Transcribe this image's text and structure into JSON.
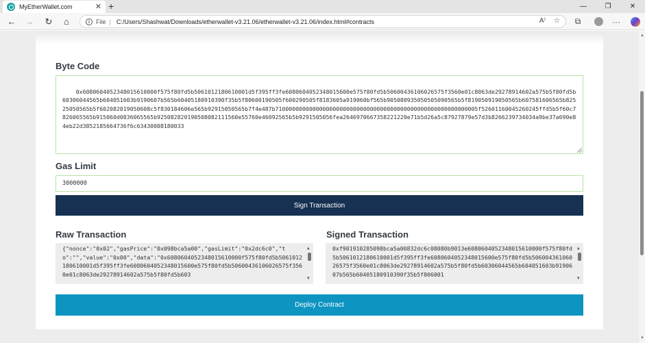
{
  "browser": {
    "tab_title": "MyEtherWallet.com",
    "tab_close": "✕",
    "new_tab": "+",
    "window_controls": {
      "minimize": "—",
      "maximize": "❐",
      "close": "✕"
    },
    "nav": {
      "back": "←",
      "forward": "→",
      "reload": "↻",
      "home": "⌂"
    },
    "address": {
      "scheme_label": "File",
      "separator": "|",
      "url": "C:/Users/Shashwat/Downloads/etherwallet-v3.21.06/etherwallet-v3.21.06/index.html#contracts"
    },
    "icons": {
      "read_aloud": "A⁾",
      "favorite": "☆",
      "extensions": "⧉",
      "more": "···"
    }
  },
  "contract": {
    "bytecode_label": "Byte Code",
    "bytecode_value": "0x6080604052348015610000f575f80fd5b5061012180610001d5f395ff3fe6080604052348015600e575f80fd5b50600436106026575f3560e01c8063de29278914602a575b5f80fd5b60306044565b604051603b9190607b565b60405180910390f35b5f80600190505f600290505f8183605a919060bf565b905080935050505090565b5f819050919050565b607581606565b82525050565b5f602082019050608c5f830184606e565b92915050565b7f4e487b710000000000000000000000000000000000000000000000000000000005f52601160045260245ffd5b5f60c7826065565b915060d0836065565b925082820190508082111560e55760e46092565b5b9291505056fea2646970667358221220e71b5d26a5c87927879e57d3b8266239734034a9be37a690e84eb22d3852185664736f6c63430008180033",
    "gas_limit_label": "Gas Limit",
    "gas_limit_value": "3000000",
    "sign_button": "Sign Transaction",
    "raw_tx_label": "Raw Transaction",
    "raw_tx_value": "{\"nonce\":\"0x02\",\"gasPrice\":\"0x098bca5a00\",\"gasLimit\":\"0x2dc6c0\",\"to\":\"\",\"value\":\"0x00\",\"data\":\"0x6080604052348015610000f575f80fd5b5061012180610001d5f395ff3fe6080604052348015600e575f80fd5b50600436106026575f3560e01c8063de29278914602a575b5f80fd5b603",
    "signed_tx_label": "Signed Transaction",
    "signed_tx_value": "0xf901910285098bca5a00832dc6c08080b9013e6080604052348015610000f575f80fd5b5061012180610001d5f395ff3fe6080604052348015600e575f80fd5b50600436106026575f3560e01c8063de29278914602a575b5f80fd5b60306044565b604051603b9190607b565b60405180910390f35b5f806001",
    "deploy_button": "Deploy Contract"
  },
  "scroll_glyphs": {
    "up": "▲",
    "down": "▼"
  },
  "colors": {
    "sign_button_bg": "#163151",
    "deploy_button_bg": "#0e94c1",
    "valid_field_border": "#b5e2a8"
  }
}
